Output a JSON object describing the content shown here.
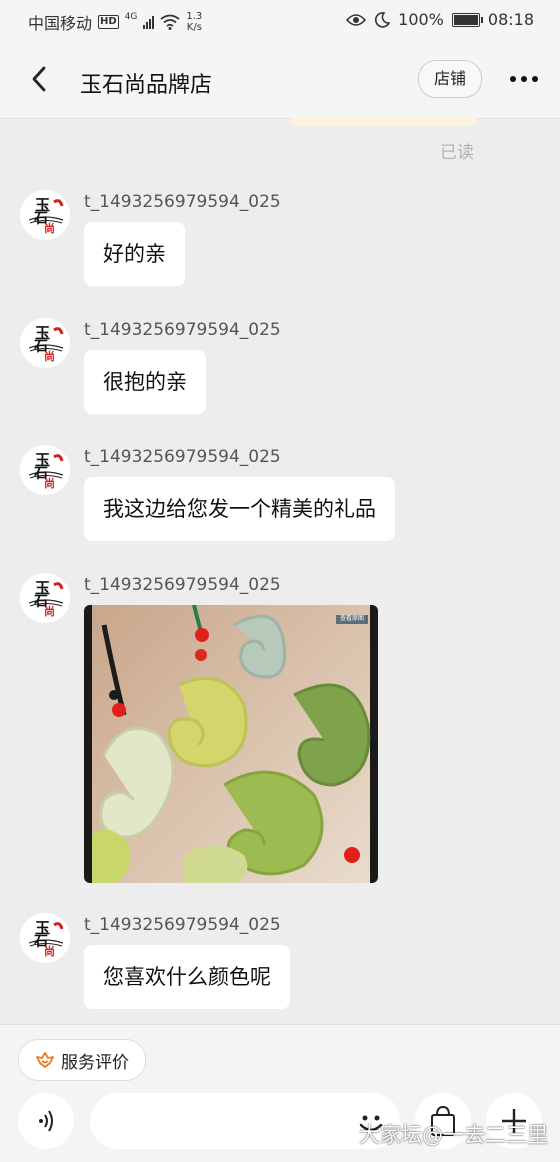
{
  "status_bar": {
    "carrier": "中国移动",
    "hd": "HD",
    "network": "4G",
    "speed_value": "1.3",
    "speed_unit": "K/s",
    "battery": "100%",
    "time": "08:18"
  },
  "nav": {
    "title": "玉石尚品牌店",
    "shop_label": "店铺"
  },
  "read_receipt": "已读",
  "messages": [
    {
      "sender": "t_1493256979594_025",
      "text": "好的亲"
    },
    {
      "sender": "t_1493256979594_025",
      "text": "很抱的亲"
    },
    {
      "sender": "t_1493256979594_025",
      "text": "我这边给您发一个精美的礼品"
    },
    {
      "sender": "t_1493256979594_025",
      "image_badge": "查看原图"
    },
    {
      "sender": "t_1493256979594_025",
      "text": "您喜欢什么颜色呢"
    }
  ],
  "avatar_text": {
    "top": "玉",
    "middle": "石",
    "bottom": "尚"
  },
  "bottom_bar": {
    "service_label": "服务评价"
  },
  "watermark": "大家坛@一去二三里",
  "icons": [
    "back-arrow-icon",
    "more-dots-icon",
    "signal-icon",
    "wifi-icon",
    "eye-icon",
    "moon-icon",
    "battery-icon",
    "service-icon",
    "voice-icon",
    "emoji-icon",
    "shopping-bag-icon",
    "plus-icon"
  ],
  "colors": {
    "accent": "#f07a1a",
    "background": "#ededed",
    "bubble": "#ffffff",
    "avatar_red": "#d62020"
  }
}
